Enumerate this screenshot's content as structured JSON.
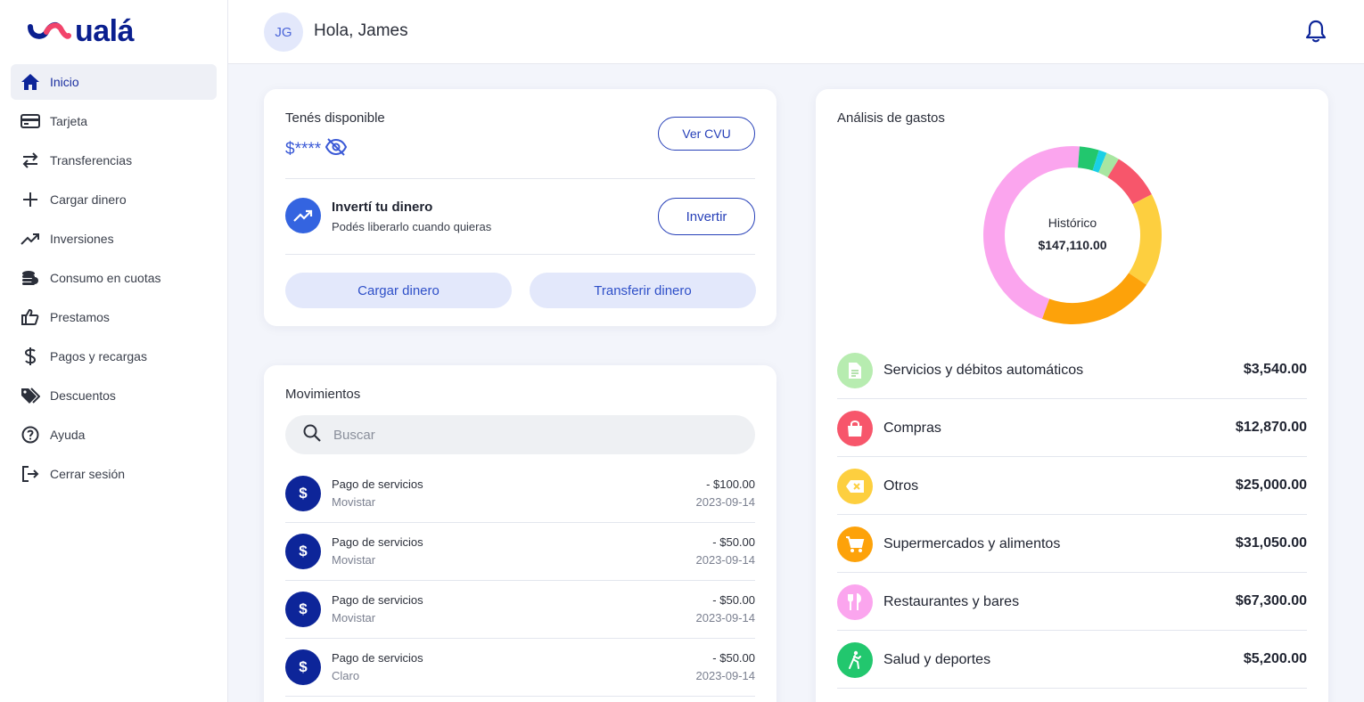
{
  "app": {
    "logo_text": "ualá"
  },
  "sidebar": {
    "items": [
      {
        "label": "Inicio",
        "icon": "home-icon",
        "active": true
      },
      {
        "label": "Tarjeta",
        "icon": "credit-card-icon"
      },
      {
        "label": "Transferencias",
        "icon": "transfer-arrows-icon"
      },
      {
        "label": "Cargar dinero",
        "icon": "plus-icon"
      },
      {
        "label": "Inversiones",
        "icon": "trending-up-icon"
      },
      {
        "label": "Consumo en cuotas",
        "icon": "coins-stack-icon"
      },
      {
        "label": "Prestamos",
        "icon": "thumbs-up-icon"
      },
      {
        "label": "Pagos y recargas",
        "icon": "dollar-icon"
      },
      {
        "label": "Descuentos",
        "icon": "tag-icon"
      },
      {
        "label": "Ayuda",
        "icon": "help-circle-icon"
      },
      {
        "label": "Cerrar sesión",
        "icon": "logout-icon"
      }
    ]
  },
  "header": {
    "avatar_initials": "JG",
    "greeting": "Hola, James"
  },
  "balance": {
    "title": "Tenés disponible",
    "amount_masked": "$****",
    "cvu_button": "Ver CVU",
    "invest_title": "Invertí tu dinero",
    "invest_subtitle": "Podés liberarlo cuando quieras",
    "invest_button": "Invertir",
    "load_button": "Cargar dinero",
    "transfer_button": "Transferir dinero"
  },
  "movements": {
    "title": "Movimientos",
    "search_placeholder": "Buscar",
    "items": [
      {
        "title": "Pago de servicios",
        "subtitle": "Movistar",
        "amount": "- $100.00",
        "date": "2023-09-14"
      },
      {
        "title": "Pago de servicios",
        "subtitle": "Movistar",
        "amount": "- $50.00",
        "date": "2023-09-14"
      },
      {
        "title": "Pago de servicios",
        "subtitle": "Movistar",
        "amount": "- $50.00",
        "date": "2023-09-14"
      },
      {
        "title": "Pago de servicios",
        "subtitle": "Claro",
        "amount": "- $50.00",
        "date": "2023-09-14"
      }
    ]
  },
  "expenses": {
    "title": "Análisis de gastos",
    "donut_label": "Histórico",
    "donut_total": "$147,110.00",
    "categories": [
      {
        "name": "Servicios y débitos automáticos",
        "amount": "$3,540.00",
        "value": 3540,
        "color": "#a8e6a1",
        "icon": "document-icon"
      },
      {
        "name": "Compras",
        "amount": "$12,870.00",
        "value": 12870,
        "color": "#f7566b",
        "icon": "shopping-bag-icon"
      },
      {
        "name": "Otros",
        "amount": "$25,000.00",
        "value": 25000,
        "color": "#fdcf3f",
        "icon": "backspace-tag-icon"
      },
      {
        "name": "Supermercados y alimentos",
        "amount": "$31,050.00",
        "value": 31050,
        "color": "#fda20a",
        "icon": "shopping-cart-icon"
      },
      {
        "name": "Restaurantes y bares",
        "amount": "$67,300.00",
        "value": 67300,
        "color": "#fba5ee",
        "icon": "fork-knife-icon"
      },
      {
        "name": "Salud y deportes",
        "amount": "$5,200.00",
        "value": 5200,
        "color": "#22c76e",
        "icon": "running-person-icon"
      }
    ],
    "extra_segments": [
      {
        "value": 2150,
        "color": "#1ad0e6"
      }
    ]
  }
}
